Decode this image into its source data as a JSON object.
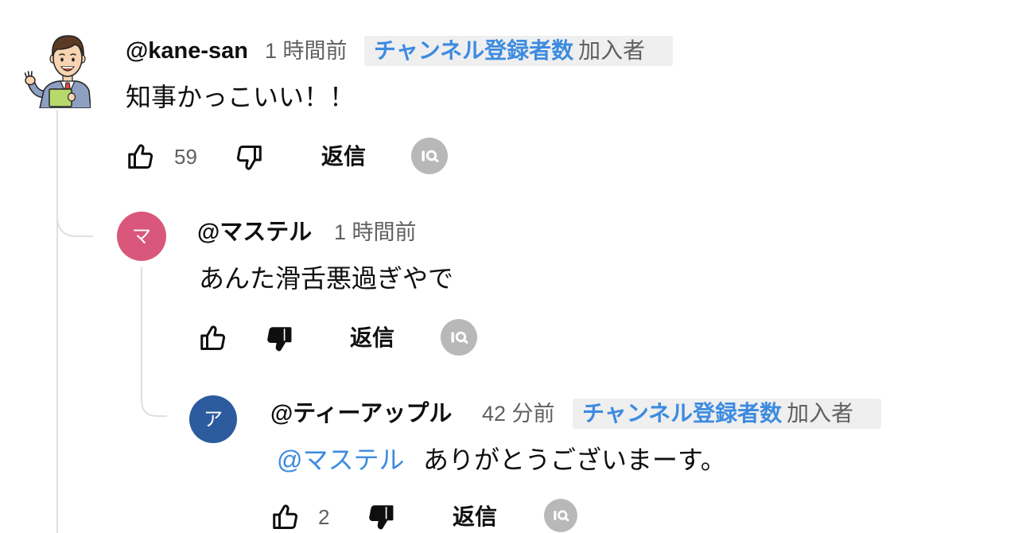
{
  "colors": {
    "text": "#0f0f0f",
    "secondary_text": "#606060",
    "link": "#3d8be0",
    "badge_background": "#efefef",
    "thread_line": "#e0e0e0",
    "extension_button": "#b8b8b8"
  },
  "comments": [
    {
      "author": "@kane-san",
      "avatar_icon": "businessman-waving-icon",
      "time": "1 時間前",
      "badge": {
        "highlight": "チャンネル登録者数",
        "label": "加入者"
      },
      "text": "知事かっこいい！！",
      "like_icon": "thumb-up-outline-icon",
      "like_count": "59",
      "dislike_icon": "thumb-down-outline-icon",
      "reply_label": "返信",
      "extension_icon": "magnifier-badge-icon"
    },
    {
      "author": "@マステル",
      "avatar_letter": "マ",
      "avatar_color": "#d9577a",
      "time": "1 時間前",
      "text": "あんた滑舌悪過ぎやで",
      "like_icon": "thumb-up-outline-icon",
      "dislike_icon": "thumb-down-filled-icon",
      "reply_label": "返信",
      "extension_icon": "magnifier-badge-icon"
    },
    {
      "author": "@ティーアップル",
      "avatar_letter": "ア",
      "avatar_color": "#2c5b9e",
      "time": "42 分前",
      "badge": {
        "highlight": "チャンネル登録者数",
        "label": "加入者"
      },
      "mention": "@マステル",
      "text": "ありがとうございまーす。",
      "like_icon": "thumb-up-outline-icon",
      "like_count": "2",
      "dislike_icon": "thumb-down-filled-icon",
      "reply_label": "返信",
      "extension_icon": "magnifier-badge-icon"
    }
  ]
}
